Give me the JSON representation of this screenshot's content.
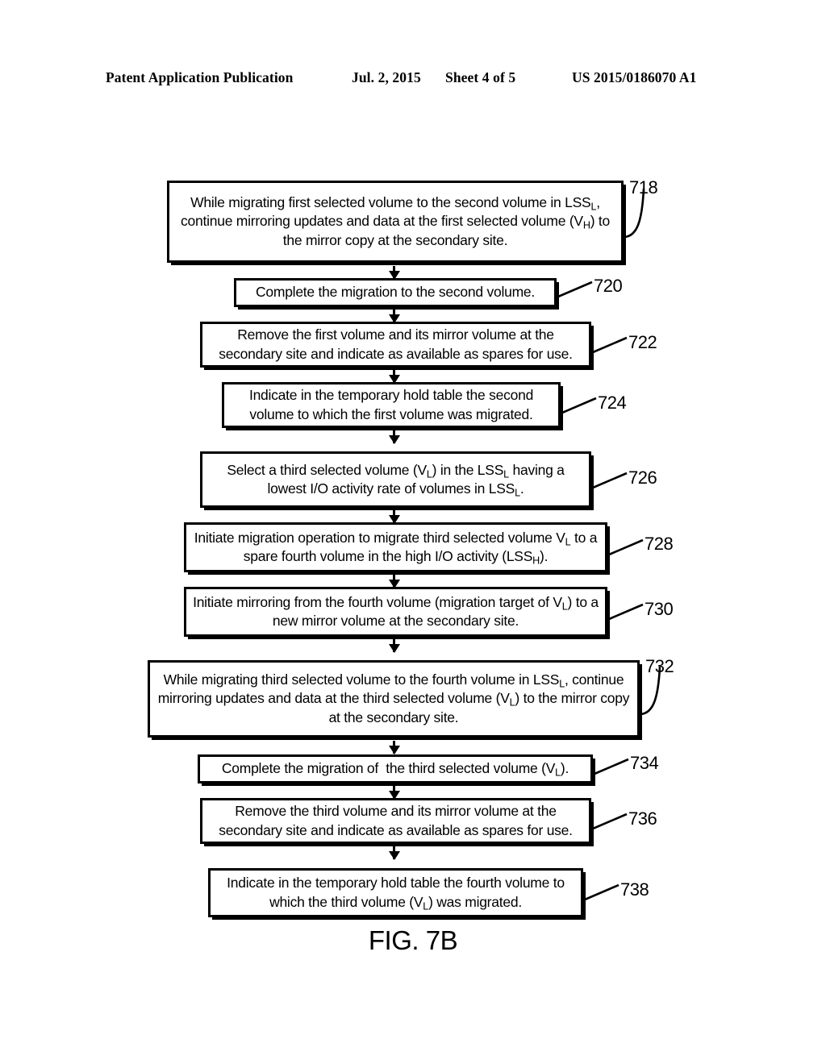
{
  "header": {
    "publication": "Patent Application Publication",
    "date": "Jul. 2, 2015",
    "sheet": "Sheet 4 of 5",
    "patent_number": "US 2015/0186070 A1"
  },
  "figure": {
    "caption": "FIG. 7B"
  },
  "flowchart": {
    "steps": [
      {
        "ref": "718",
        "text_html": "While migrating first selected volume to the second volume in LSS<sub>L</sub>, continue mirroring updates and data at the first selected volume (V<sub>H</sub>) to the mirror copy at the secondary site.",
        "text_plain": "While migrating first selected volume to the second volume in LSSL, continue mirroring updates and data at the first selected volume (VH) to the mirror copy at the secondary site."
      },
      {
        "ref": "720",
        "text_html": "Complete the migration to the second volume.",
        "text_plain": "Complete the migration to the second volume."
      },
      {
        "ref": "722",
        "text_html": "Remove the first volume and its mirror volume at the secondary site and indicate as available as spares for use.",
        "text_plain": "Remove the first volume and its mirror volume at the secondary site and indicate as available as spares for use."
      },
      {
        "ref": "724",
        "text_html": "Indicate in the temporary hold table the second volume to which the first volume was migrated.",
        "text_plain": "Indicate in the temporary hold table the second volume to which the first volume was migrated."
      },
      {
        "ref": "726",
        "text_html": "Select a third selected volume (V<sub>L</sub>) in the LSS<sub>L</sub> having a lowest I/O activity rate of volumes in LSS<sub>L</sub>.",
        "text_plain": "Select a third selected volume (VL) in the LSSL having a lowest I/O activity rate of volumes in LSSL."
      },
      {
        "ref": "728",
        "text_html": "Initiate migration operation to migrate third selected volume V<sub>L</sub> to a spare fourth volume in the high I/O activity (LSS<sub>H</sub>).",
        "text_plain": "Initiate migration operation to migrate third selected volume VL to a spare fourth volume in the high I/O activity (LSSH)."
      },
      {
        "ref": "730",
        "text_html": "Initiate mirroring from the fourth volume (migration target of V<sub>L</sub>) to a new mirror volume at the secondary site.",
        "text_plain": "Initiate mirroring from the fourth volume (migration target of VL) to a new mirror volume at the secondary site."
      },
      {
        "ref": "732",
        "text_html": "While migrating third selected volume to the fourth volume in LSS<sub>L</sub>, continue mirroring updates and data at the third selected volume (V<sub>L</sub>) to the mirror copy at the secondary site.",
        "text_plain": "While migrating third selected volume to the fourth volume in LSSL, continue mirroring updates and data at the third selected volume (VL) to the mirror copy at the secondary site."
      },
      {
        "ref": "734",
        "text_html": "Complete the migration of&nbsp; the third selected volume (V<sub>L</sub>).",
        "text_plain": "Complete the migration of  the third selected volume (VL)."
      },
      {
        "ref": "736",
        "text_html": "Remove the third volume and its mirror volume at the secondary site and indicate as available as spares for use.",
        "text_plain": "Remove the third volume and its mirror volume at the secondary site and indicate as available as spares for use."
      },
      {
        "ref": "738",
        "text_html": "Indicate in the temporary hold table the fourth volume to which the third volume (V<sub>L</sub>) was migrated.",
        "text_plain": "Indicate in the temporary hold table the fourth volume to which the third volume (VL) was migrated."
      }
    ]
  },
  "colors": {
    "ink": "#000000",
    "paper": "#ffffff"
  }
}
